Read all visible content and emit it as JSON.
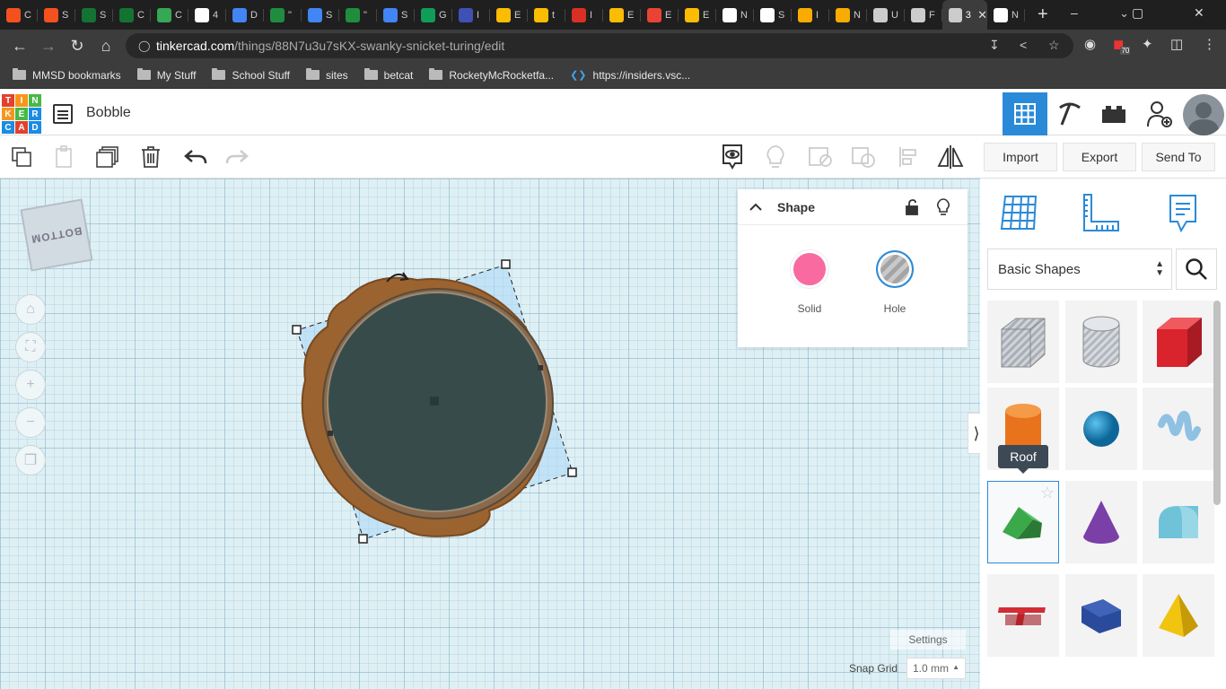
{
  "browser": {
    "tabs": [
      {
        "icon": "slides-icon",
        "color": "#f4511e",
        "label": "C"
      },
      {
        "icon": "slides-icon",
        "color": "#f4511e",
        "label": "S"
      },
      {
        "icon": "globe-icon",
        "color": "#137333",
        "label": "S"
      },
      {
        "icon": "globe-icon",
        "color": "#137333",
        "label": "C"
      },
      {
        "icon": "shield-icon",
        "color": "#34a853",
        "label": "C"
      },
      {
        "icon": "google-icon",
        "color": "#ffffff",
        "label": "4"
      },
      {
        "icon": "grid-icon",
        "color": "#4285f4",
        "label": "D"
      },
      {
        "icon": "classroom-icon",
        "color": "#1e8e3e",
        "label": "\""
      },
      {
        "icon": "docs-icon",
        "color": "#4285f4",
        "label": "S"
      },
      {
        "icon": "classroom-icon",
        "color": "#1e8e3e",
        "label": "\""
      },
      {
        "icon": "docs-icon",
        "color": "#4285f4",
        "label": "S"
      },
      {
        "icon": "sheets-icon",
        "color": "#0f9d58",
        "label": "G"
      },
      {
        "icon": "square-icon",
        "color": "#3f51b5",
        "label": "I"
      },
      {
        "icon": "hex-icon",
        "color": "#fbbc04",
        "label": "E"
      },
      {
        "icon": "hex-icon",
        "color": "#fbbc04",
        "label": "t"
      },
      {
        "icon": "diamond-icon",
        "color": "#d93025",
        "label": "I"
      },
      {
        "icon": "hex-icon",
        "color": "#fbbc04",
        "label": "E"
      },
      {
        "icon": "gmail-icon",
        "color": "#ea4335",
        "label": "E"
      },
      {
        "icon": "hex-icon",
        "color": "#fbbc04",
        "label": "E"
      },
      {
        "icon": "chrome-icon",
        "color": "#ffffff",
        "label": "N"
      },
      {
        "icon": "gear-icon",
        "color": "#ffffff",
        "label": "S"
      },
      {
        "icon": "avatar-icon",
        "color": "#f9ab00",
        "label": "I"
      },
      {
        "icon": "avatar-icon",
        "color": "#f9ab00",
        "label": "N"
      },
      {
        "icon": "diamond-icon",
        "color": "#cccccc",
        "label": "U"
      },
      {
        "icon": "layers-icon",
        "color": "#cccccc",
        "label": "F"
      },
      {
        "icon": "tinkercad-icon",
        "color": "#cccccc",
        "label": "3",
        "active": true
      },
      {
        "icon": "chrome-icon",
        "color": "#ffffff",
        "label": "N"
      }
    ],
    "address": {
      "domain": "tinkercad.com",
      "path": "/things/88N7u3u7sKX-swanky-snicket-turing/edit"
    },
    "extension_badge": "70",
    "bookmarks": [
      {
        "icon": "folder-icon",
        "label": "MMSD bookmarks"
      },
      {
        "icon": "folder-icon",
        "label": "My Stuff"
      },
      {
        "icon": "folder-icon",
        "label": "School Stuff"
      },
      {
        "icon": "folder-icon",
        "label": "sites"
      },
      {
        "icon": "folder-icon",
        "label": "betcat"
      },
      {
        "icon": "folder-icon",
        "label": "RocketyMcRocketfa..."
      },
      {
        "icon": "vscode-icon",
        "label": "https://insiders.vsc..."
      }
    ]
  },
  "app": {
    "logo_letters": [
      "T",
      "I",
      "N",
      "K",
      "E",
      "R",
      "C",
      "A",
      "D"
    ],
    "logo_colors": [
      "#e2412f",
      "#f8951d",
      "#48b946",
      "#f8951d",
      "#48b946",
      "#1a8ce3",
      "#1a8ce3",
      "#e2412f",
      "#1a8ce3"
    ],
    "design_title": "Bobble",
    "accent": "#2a8ad8"
  },
  "toolbar": {
    "import_label": "Import",
    "export_label": "Export",
    "send_label": "Send To"
  },
  "shape_panel": {
    "title": "Shape",
    "solid_label": "Solid",
    "solid_color": "#f86aa0",
    "hole_label": "Hole"
  },
  "workplane": {
    "viewcube_face": "BOTTOM",
    "settings_label": "Settings",
    "snap_label": "Snap Grid",
    "snap_value": "1.0 mm"
  },
  "library": {
    "category": "Basic Shapes",
    "tooltip": "Roof",
    "shapes": [
      {
        "name": "box-hole",
        "color": "#b9bec6"
      },
      {
        "name": "cylinder-hole",
        "color": "#c7cbd1"
      },
      {
        "name": "box",
        "color": "#d9232d"
      },
      {
        "name": "cylinder",
        "color": "#e8731c"
      },
      {
        "name": "sphere",
        "color": "#1a8dc8"
      },
      {
        "name": "scribble",
        "color": "#8fc1e3"
      },
      {
        "name": "roof",
        "color": "#3ba84a"
      },
      {
        "name": "cone",
        "color": "#7b3fa8"
      },
      {
        "name": "round-roof",
        "color": "#6fc3d8"
      },
      {
        "name": "text",
        "color": "#d22c35"
      },
      {
        "name": "wedge",
        "color": "#2a4a9c"
      },
      {
        "name": "pyramid",
        "color": "#f1c40f"
      }
    ]
  }
}
